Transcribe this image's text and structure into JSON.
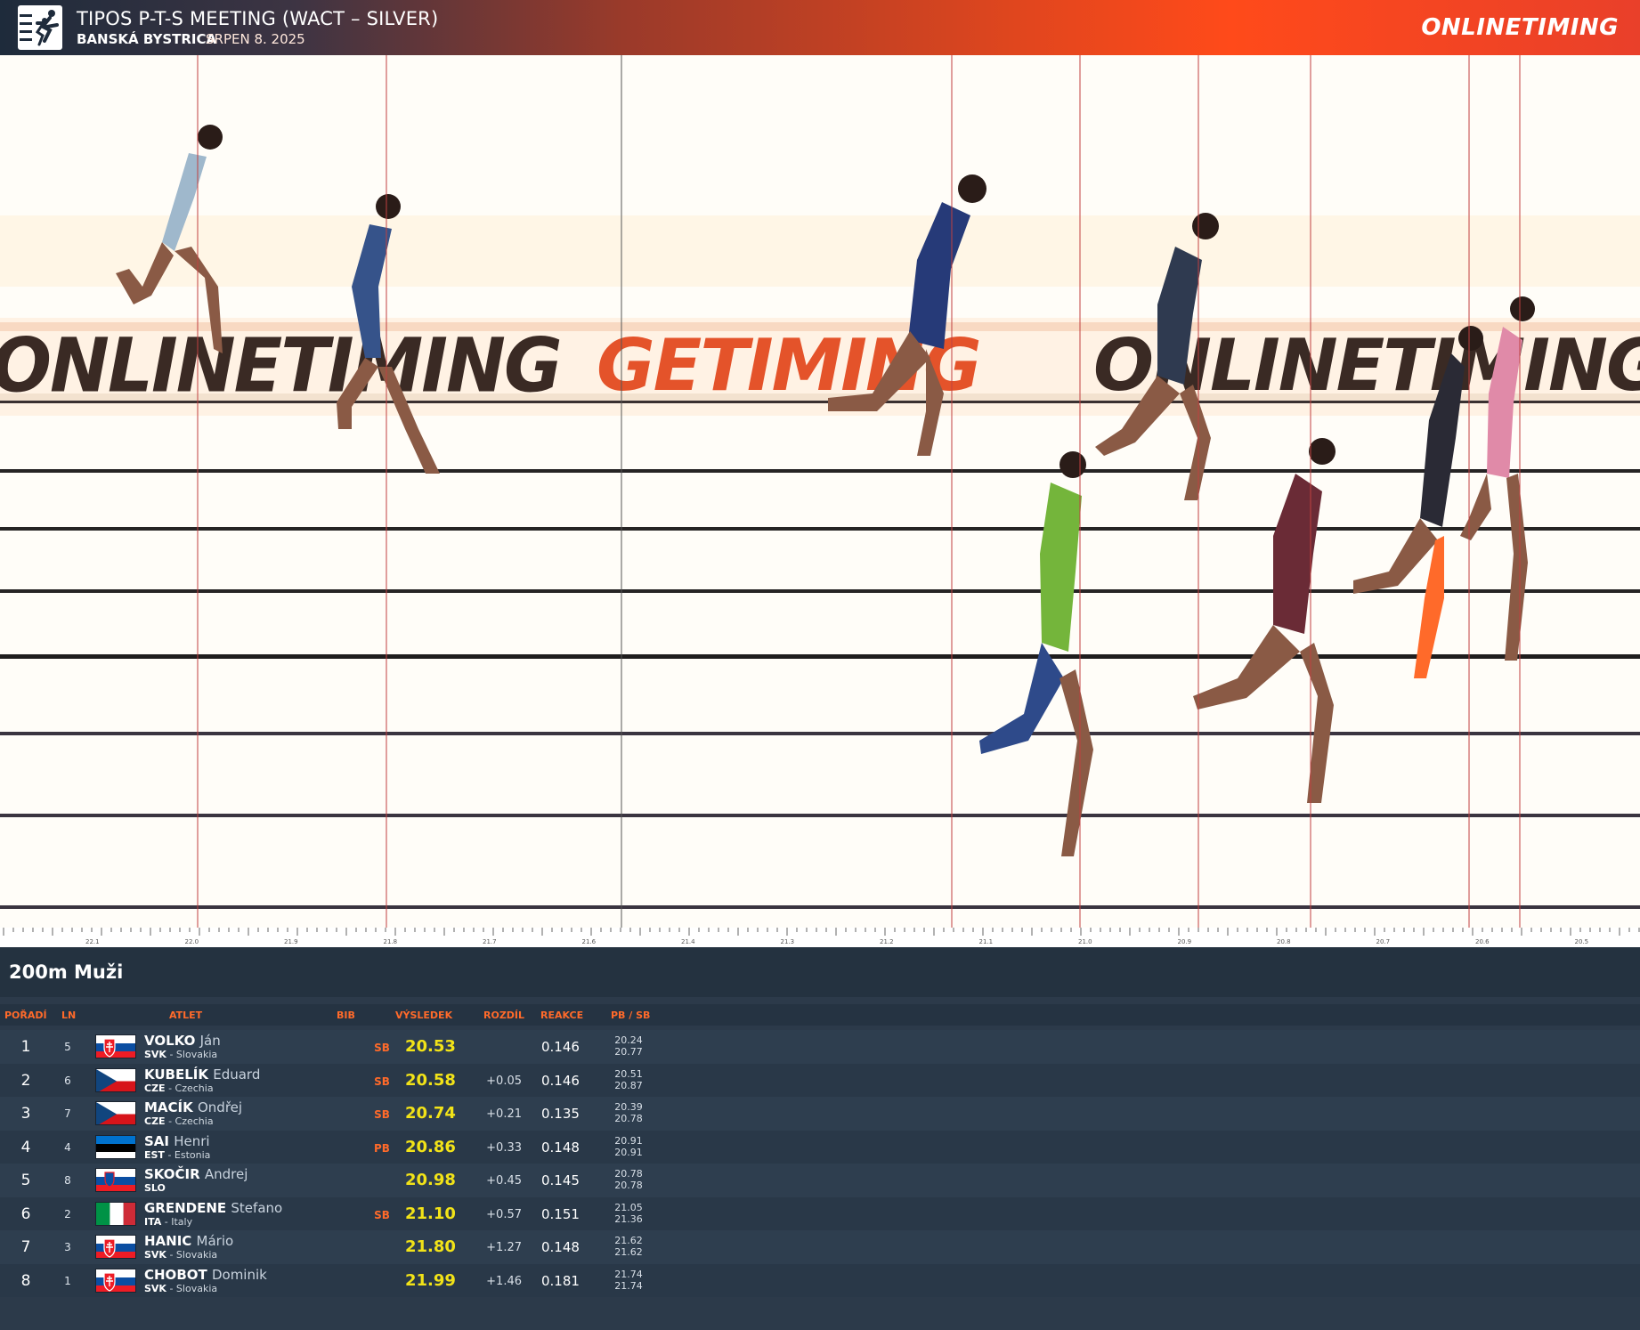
{
  "header": {
    "title": "TIPOS P-T-S MEETING (WACT – SILVER)",
    "city": "BANSKÁ BYSTRICA",
    "date": "SRPEN 8. 2025",
    "brand": "ONLINETIMING",
    "logo_icon": "running-athletes-icon"
  },
  "photo": {
    "banner_left": "ONLINETIMING",
    "banner_center": "GETIMING",
    "banner_right": "ONLINETIMING"
  },
  "ruler": {
    "ticks": [
      "22.1",
      "22.0",
      "21.9",
      "21.8",
      "21.7",
      "21.6",
      "21.4",
      "21.3",
      "21.2",
      "21.1",
      "21.0",
      "20.9",
      "20.8",
      "20.7",
      "20.6",
      "20.5"
    ]
  },
  "event": {
    "title": "200m Muži"
  },
  "columns": {
    "place": "POŘADÍ",
    "lane": "LN",
    "athlete": "ATLET",
    "bib": "BIB",
    "result": "VÝSLEDEK",
    "diff": "ROZDÍL",
    "reaction": "REAKCE",
    "pbsb": "PB / SB"
  },
  "results": [
    {
      "place": "1",
      "lane": "5",
      "surname": "VOLKO",
      "firstname": "Ján",
      "code": "SVK",
      "country": " - Slovakia",
      "flag": "svk",
      "record": "SB",
      "result": "20.53",
      "diff": "",
      "reaction": "0.146",
      "pb": "20.24",
      "sb": "20.77"
    },
    {
      "place": "2",
      "lane": "6",
      "surname": "KUBELÍK",
      "firstname": "Eduard",
      "code": "CZE",
      "country": " - Czechia",
      "flag": "cze",
      "record": "SB",
      "result": "20.58",
      "diff": "+0.05",
      "reaction": "0.146",
      "pb": "20.51",
      "sb": "20.87"
    },
    {
      "place": "3",
      "lane": "7",
      "surname": "MACÍK",
      "firstname": "Ondřej",
      "code": "CZE",
      "country": " - Czechia",
      "flag": "cze",
      "record": "SB",
      "result": "20.74",
      "diff": "+0.21",
      "reaction": "0.135",
      "pb": "20.39",
      "sb": "20.78"
    },
    {
      "place": "4",
      "lane": "4",
      "surname": "SAI",
      "firstname": "Henri",
      "code": "EST",
      "country": " - Estonia",
      "flag": "est",
      "record": "PB",
      "result": "20.86",
      "diff": "+0.33",
      "reaction": "0.148",
      "pb": "20.91",
      "sb": "20.91"
    },
    {
      "place": "5",
      "lane": "8",
      "surname": "SKOČIR",
      "firstname": "Andrej",
      "code": "SLO",
      "country": "",
      "flag": "slo",
      "record": "",
      "result": "20.98",
      "diff": "+0.45",
      "reaction": "0.145",
      "pb": "20.78",
      "sb": "20.78"
    },
    {
      "place": "6",
      "lane": "2",
      "surname": "GRENDENE",
      "firstname": "Stefano",
      "code": "ITA",
      "country": " - Italy",
      "flag": "ita",
      "record": "SB",
      "result": "21.10",
      "diff": "+0.57",
      "reaction": "0.151",
      "pb": "21.05",
      "sb": "21.36"
    },
    {
      "place": "7",
      "lane": "3",
      "surname": "HANIC",
      "firstname": "Mário",
      "code": "SVK",
      "country": " - Slovakia",
      "flag": "svk",
      "record": "",
      "result": "21.80",
      "diff": "+1.27",
      "reaction": "0.148",
      "pb": "21.62",
      "sb": "21.62"
    },
    {
      "place": "8",
      "lane": "1",
      "surname": "CHOBOT",
      "firstname": "Dominik",
      "code": "SVK",
      "country": " - Slovakia",
      "flag": "svk",
      "record": "",
      "result": "21.99",
      "diff": "+1.46",
      "reaction": "0.181",
      "pb": "21.74",
      "sb": "21.74"
    }
  ]
}
